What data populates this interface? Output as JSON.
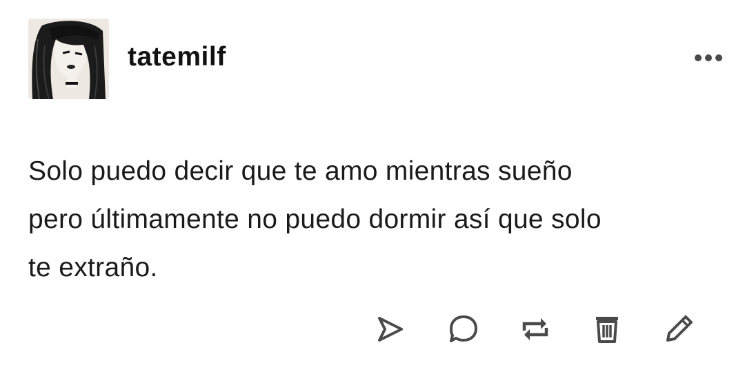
{
  "post": {
    "username": "tatemilf",
    "body": "Solo puedo decir que te amo mientras sueño\npero últimamente no puedo dormir así que solo\nte extraño."
  },
  "icons": {
    "more": "more-horizontal-icon",
    "share": "send-icon",
    "reply": "comment-icon",
    "reblog": "reblog-icon",
    "delete": "trash-icon",
    "edit": "pencil-icon"
  },
  "colors": {
    "text": "#1a1a1a",
    "icon": "#4a4a4a",
    "background": "#ffffff"
  }
}
